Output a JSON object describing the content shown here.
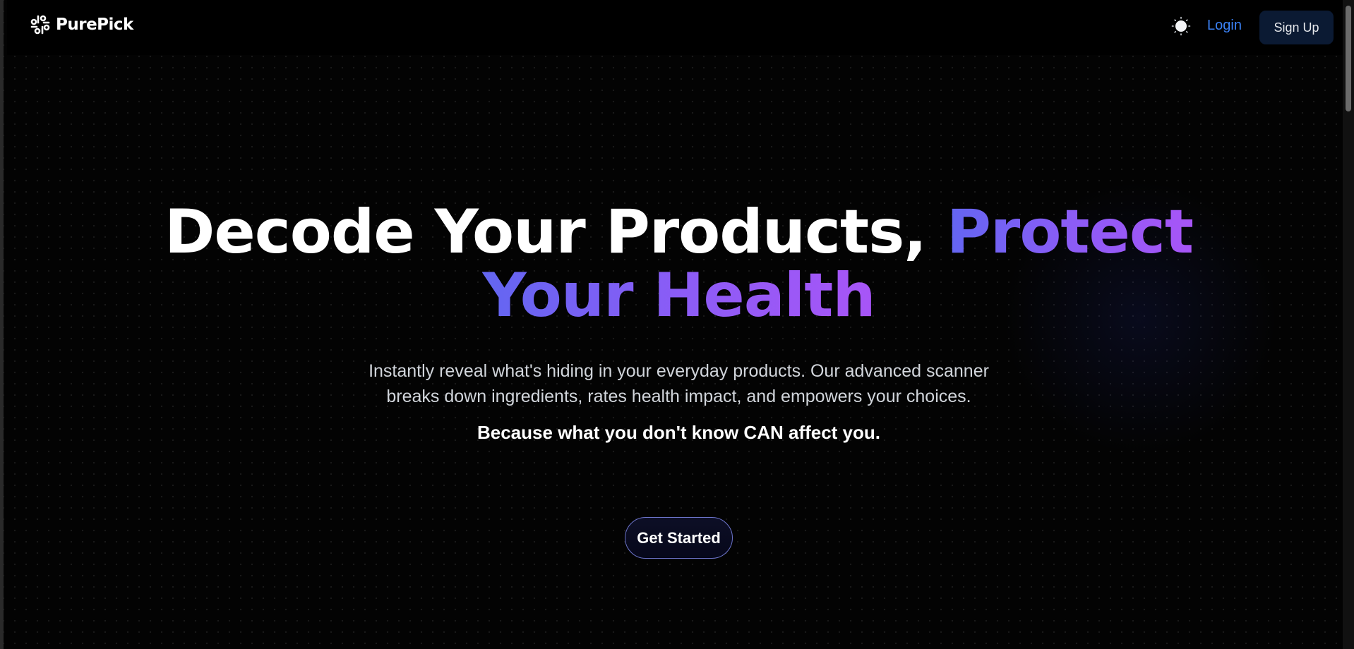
{
  "header": {
    "brand": {
      "name": "PurePick",
      "icon": "purepick-logo-icon"
    },
    "theme_toggle": {
      "icon": "sun-icon"
    },
    "login_label": "Login",
    "signup_label": "Sign Up"
  },
  "hero": {
    "title_part1": "Decode Your Products, ",
    "title_part2_accent": "Protect",
    "title_part3_accent": "Your Health",
    "subtitle_line1": "Instantly reveal what's hiding in your everyday products. Our advanced scanner",
    "subtitle_line2": "breaks down ingredients, rates health impact, and empowers your choices.",
    "tagline": "Because what you don't know CAN affect you.",
    "cta_label": "Get Started"
  },
  "colors": {
    "background": "#000000",
    "accent_gradient_start": "#6366f1",
    "accent_gradient_end": "#a855f7",
    "login_link": "#3b82f6",
    "signup_bg": "#0b1a33"
  }
}
